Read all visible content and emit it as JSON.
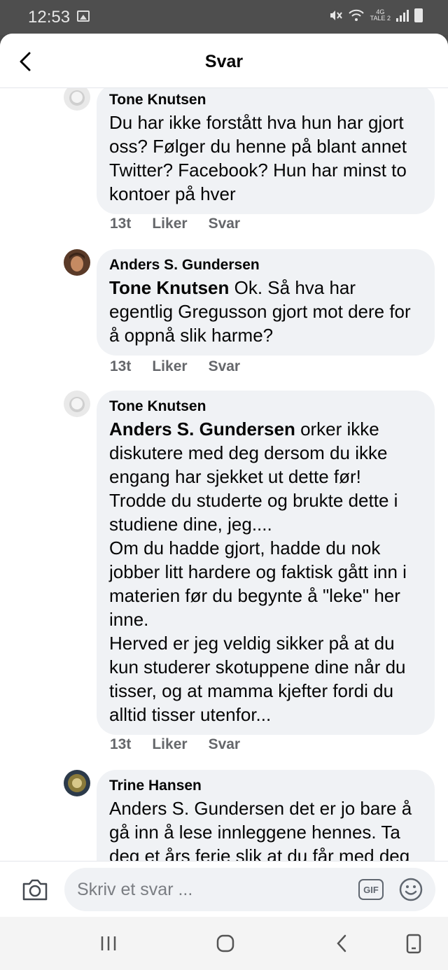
{
  "status_bar": {
    "time": "12:53",
    "network_top": "4G",
    "network_bottom": "TALE 2",
    "icons": [
      "gallery-icon",
      "mute-icon",
      "wifi-icon",
      "signal-icon",
      "battery-icon"
    ]
  },
  "header": {
    "title": "Svar",
    "back_icon": "chevron-left-icon"
  },
  "comments": [
    {
      "author": "Tone Knutsen",
      "mention": "",
      "text": "Du har ikke forstått hva hun har gjort oss? Følger du henne på blant annet Twitter? Facebook? Hun har minst to kontoer på hver",
      "time": "13t",
      "like_label": "Liker",
      "reply_label": "Svar"
    },
    {
      "author": "Anders S. Gundersen",
      "mention": "Tone Knutsen",
      "text": " Ok. Så hva har egentlig Gregusson gjort mot dere for å oppnå slik harme?",
      "time": "13t",
      "like_label": "Liker",
      "reply_label": "Svar"
    },
    {
      "author": "Tone Knutsen",
      "mention": "Anders S. Gundersen",
      "text": " orker ikke diskutere med deg dersom du ikke engang har sjekket ut dette før!\nTrodde du studerte og brukte dette i studiene dine, jeg....\nOm du hadde gjort, hadde du nok jobber litt hardere og faktisk gått inn i materien før du begynte å \"leke\" her inne.\nHerved er jeg veldig sikker på at du kun studerer skotuppene dine når du tisser, og at mamma kjefter fordi du alltid tisser utenfor...",
      "time": "13t",
      "like_label": "Liker",
      "reply_label": "Svar"
    },
    {
      "author": "Trine Hansen",
      "mention": "",
      "text": "Anders S. Gundersen det er jo bare å gå inn å lese innleggene hennes. Ta deg et års ferie slik at du får med deg",
      "time": "",
      "like_label": "",
      "reply_label": ""
    }
  ],
  "composer": {
    "placeholder": "Skriv et svar ...",
    "gif_label": "GIF",
    "camera_icon": "camera-icon",
    "emoji_icon": "emoji-icon"
  },
  "nav_bar": {
    "icons": [
      "recent-apps-icon",
      "home-icon",
      "back-icon",
      "rotate-icon"
    ]
  },
  "colors": {
    "bubble": "#f0f2f5",
    "meta_text": "#65676b",
    "status_bar": "#4e4e4e",
    "nav_bar": "#f4f4f4"
  }
}
